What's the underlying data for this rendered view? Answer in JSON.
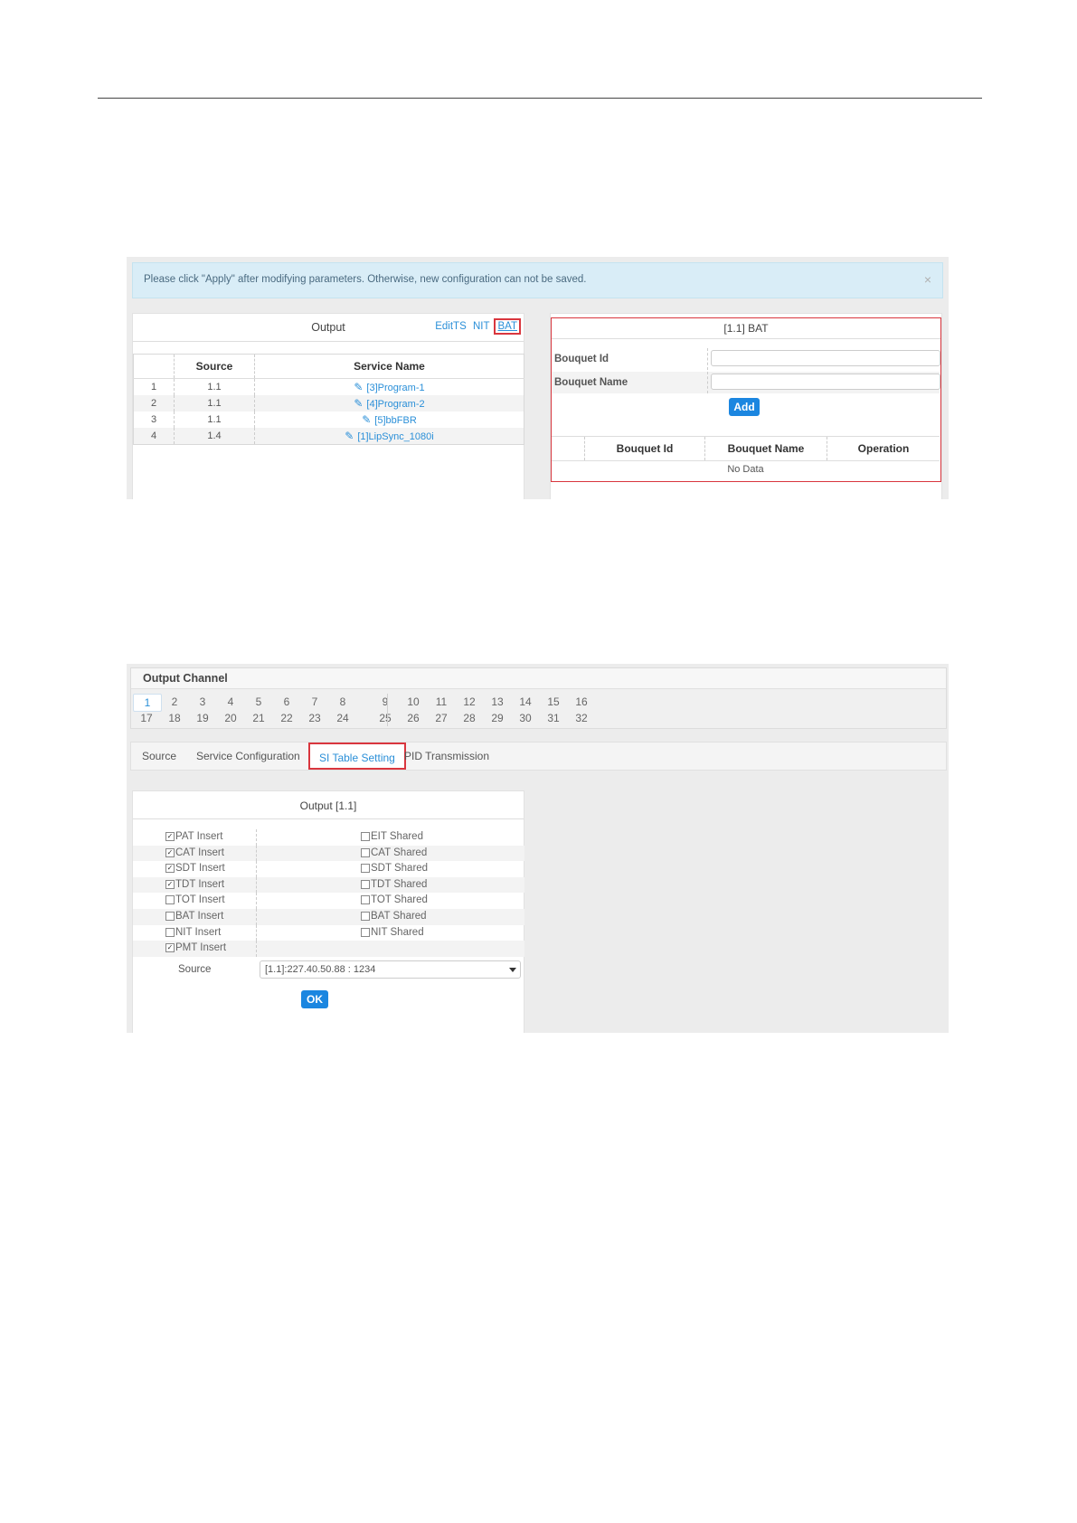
{
  "screenshot1": {
    "alert": {
      "message": "Please click \"Apply\" after modifying parameters. Otherwise, new configuration can not be saved.",
      "close": "×"
    },
    "output_panel": {
      "title": "Output",
      "links": {
        "edit_ts": "EditTS",
        "nit": "NIT",
        "bat": "BAT"
      },
      "columns": [
        "",
        "Source",
        "Service Name"
      ],
      "rows": [
        {
          "index": "1",
          "source": "1.1",
          "service": "[3]Program-1"
        },
        {
          "index": "2",
          "source": "1.1",
          "service": "[4]Program-2"
        },
        {
          "index": "3",
          "source": "1.1",
          "service": "[5]bbFBR"
        },
        {
          "index": "4",
          "source": "1.4",
          "service": "[1]LipSync_1080i"
        }
      ]
    },
    "bat_panel": {
      "title": "[1.1] BAT",
      "bouquet_id_label": "Bouquet Id",
      "bouquet_name_label": "Bouquet Name",
      "bouquet_id_value": "",
      "bouquet_name_value": "",
      "add_button": "Add",
      "columns": [
        "",
        "Bouquet Id",
        "Bouquet Name",
        "Operation"
      ],
      "empty_text": "No Data"
    }
  },
  "screenshot2": {
    "output_channel": {
      "title": "Output Channel",
      "active": "1",
      "row1_a": [
        "1",
        "2",
        "3",
        "4",
        "5",
        "6",
        "7",
        "8"
      ],
      "row1_b": [
        "9",
        "10",
        "11",
        "12",
        "13",
        "14",
        "15",
        "16"
      ],
      "row2_a": [
        "17",
        "18",
        "19",
        "20",
        "21",
        "22",
        "23",
        "24"
      ],
      "row2_b": [
        "25",
        "26",
        "27",
        "28",
        "29",
        "30",
        "31",
        "32"
      ]
    },
    "tabs": [
      "Source",
      "Service Configuration",
      "SI Table Setting",
      "PID Transmission"
    ],
    "active_tab": "SI Table Setting",
    "si_panel": {
      "title": "Output  [1.1]",
      "rows": [
        {
          "left": "PAT Insert",
          "left_checked": true,
          "right": "EIT Shared",
          "right_checked": false
        },
        {
          "left": "CAT Insert",
          "left_checked": true,
          "right": "CAT Shared",
          "right_checked": false
        },
        {
          "left": "SDT Insert",
          "left_checked": true,
          "right": "SDT Shared",
          "right_checked": false
        },
        {
          "left": "TDT Insert",
          "left_checked": true,
          "right": "TDT Shared",
          "right_checked": false
        },
        {
          "left": "TOT Insert",
          "left_checked": false,
          "right": "TOT Shared",
          "right_checked": false
        },
        {
          "left": "BAT Insert",
          "left_checked": false,
          "right": "BAT Shared",
          "right_checked": false
        },
        {
          "left": "NIT Insert",
          "left_checked": false,
          "right": "NIT Shared",
          "right_checked": false
        },
        {
          "left": "PMT Insert",
          "left_checked": true,
          "right": "",
          "right_checked": false
        }
      ],
      "source_label": "Source",
      "source_value": "[1.1]:227.40.50.88 : 1234",
      "ok_button": "OK"
    }
  },
  "colors": {
    "accent": "#1b86e0",
    "link": "#2a8fd8",
    "highlight_box": "#d9363e",
    "alert_bg": "#d9edf7"
  },
  "icons": {
    "edit": "pencil-icon",
    "close": "close-icon",
    "dropdown": "caret-down-icon"
  }
}
